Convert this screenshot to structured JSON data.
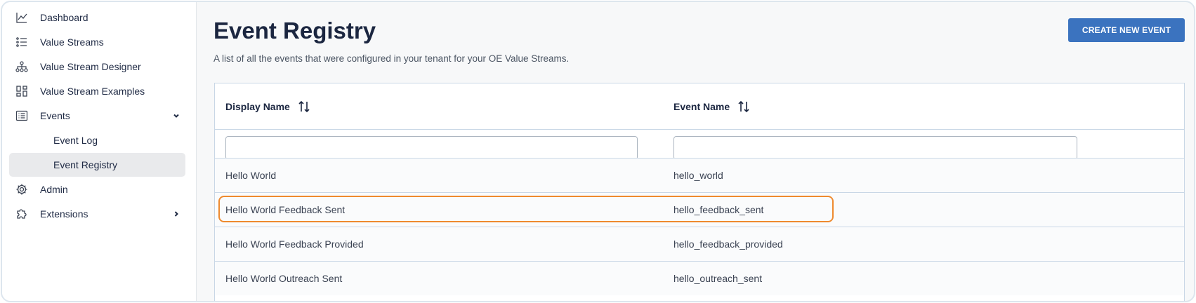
{
  "sidebar": {
    "items": [
      {
        "label": "Dashboard",
        "icon": "chart-line-icon"
      },
      {
        "label": "Value Streams",
        "icon": "list-numbered-icon"
      },
      {
        "label": "Value Stream Designer",
        "icon": "hierarchy-icon"
      },
      {
        "label": "Value Stream Examples",
        "icon": "dashboard-grid-icon"
      },
      {
        "label": "Events",
        "icon": "list-box-icon",
        "expanded": true
      },
      {
        "label": "Event Log"
      },
      {
        "label": "Event Registry",
        "active": true
      },
      {
        "label": "Admin",
        "icon": "gear-icon"
      },
      {
        "label": "Extensions",
        "icon": "puzzle-icon",
        "expanded": false
      }
    ]
  },
  "main": {
    "title": "Event Registry",
    "subtitle": "A list of all the events that were configured in your tenant for your OE Value Streams.",
    "create_button": "CREATE NEW EVENT"
  },
  "table": {
    "columns": [
      "Display Name",
      "Event Name"
    ],
    "filters": [
      "",
      ""
    ],
    "rows": [
      {
        "display_name": "Hello World",
        "event_name": "hello_world"
      },
      {
        "display_name": "Hello World Feedback Sent",
        "event_name": "hello_feedback_sent",
        "highlighted": true
      },
      {
        "display_name": "Hello World Feedback Provided",
        "event_name": "hello_feedback_provided"
      },
      {
        "display_name": "Hello World Outreach Sent",
        "event_name": "hello_outreach_sent"
      }
    ]
  },
  "colors": {
    "accent": "#3b73bf",
    "highlight": "#ee8a2f",
    "active_nav": "#e9eaec",
    "border": "#c9d7e6"
  }
}
